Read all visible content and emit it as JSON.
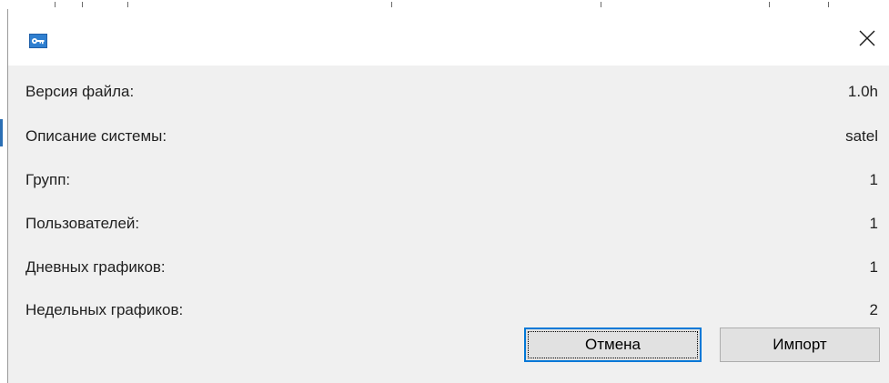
{
  "dialog": {
    "icon": "key-icon",
    "close_icon": "close-icon",
    "accent_color": "#0078d7"
  },
  "info": {
    "rows": [
      {
        "label": "Версия файла:",
        "value": "1.0h"
      },
      {
        "label": "Описание системы:",
        "value": "satel"
      },
      {
        "label": "Групп:",
        "value": "1"
      },
      {
        "label": "Пользователей:",
        "value": "1"
      },
      {
        "label": "Дневных графиков:",
        "value": "1"
      },
      {
        "label": "Недельных графиков:",
        "value": "2"
      }
    ]
  },
  "buttons": {
    "cancel_label": "Отмена",
    "import_label": "Импорт"
  }
}
